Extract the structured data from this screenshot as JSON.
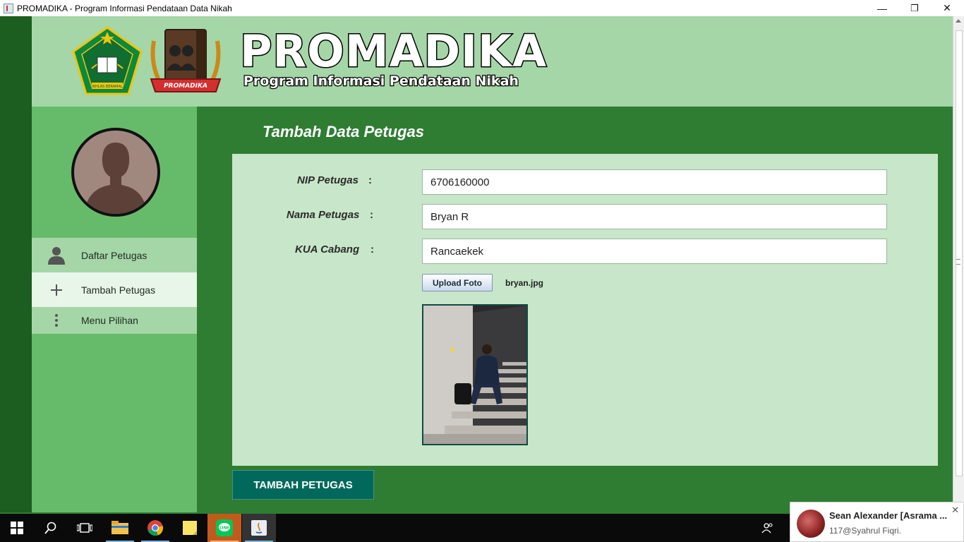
{
  "window": {
    "title": "PROMADIKA - Program Informasi Pendataan Data Nikah",
    "minimize": "—",
    "restore": "❐",
    "close": "✕"
  },
  "header": {
    "brand_title": "PROMADIKA",
    "brand_subtitle": "Program Informasi Pendataan Nikah",
    "logo_kemenag_text": "IKHLAS BERAMAL",
    "logo_promadika_text": "PROMADIKA"
  },
  "sidebar": {
    "items": [
      {
        "label": "Daftar Petugas",
        "icon": "user-icon"
      },
      {
        "label": "Tambah Petugas",
        "icon": "plus-icon"
      },
      {
        "label": "Menu Pilihan",
        "icon": "more-vertical-icon"
      }
    ]
  },
  "main": {
    "page_title": "Tambah Data Petugas",
    "form": {
      "nip_label": "NIP Petugas",
      "nip_value": "6706160000",
      "nama_label": "Nama Petugas",
      "nama_value": "Bryan R",
      "kua_label": "KUA Cabang",
      "kua_value": "Rancaekek",
      "colon": ":",
      "upload_label": "Upload Foto",
      "file_name": "bryan.jpg"
    },
    "submit_label": "TAMBAH PETUGAS"
  },
  "notification": {
    "name": "Sean Alexander [Asrama ...",
    "message": "117@Syahrul Fiqri."
  },
  "colors": {
    "dark_green": "#2e7d32",
    "header_green": "#a5d6a7",
    "sidebar_green": "#66bb6a",
    "panel_green": "#c8e6c9",
    "button_teal": "#00695c"
  }
}
